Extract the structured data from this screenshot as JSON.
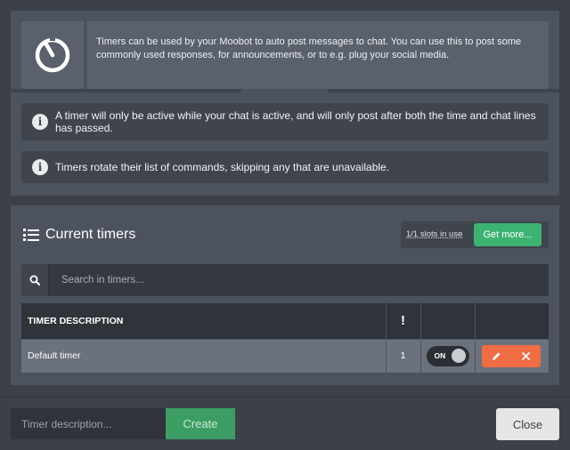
{
  "intro": {
    "description": "Timers can be used by your Moobot to auto post messages to chat. You can use this to post some commonly used responses, for announcements, or to e.g. plug your social media.",
    "icon": "timer-icon"
  },
  "info": [
    {
      "icon": "info-icon",
      "text": "A timer will only be active while your chat is active, and will only post after both the time and chat lines has passed."
    },
    {
      "icon": "info-icon",
      "text": "Timers rotate their list of commands, skipping any that are unavailable."
    }
  ],
  "timers": {
    "title": "Current timers",
    "slots_text": "1/1 slots in use",
    "get_more_label": "Get more...",
    "search_placeholder": "Search in timers...",
    "columns": {
      "description": "TIMER DESCRIPTION",
      "lines": "!"
    },
    "rows": [
      {
        "description": "Default timer",
        "lines": "1",
        "toggle_label": "ON",
        "enabled": true
      }
    ]
  },
  "footer": {
    "description_placeholder": "Timer description...",
    "create_label": "Create",
    "close_label": "Close"
  },
  "colors": {
    "success": "#3cb371",
    "danger": "#f06c43",
    "panel": "#4d535e",
    "background": "#3b4049"
  }
}
